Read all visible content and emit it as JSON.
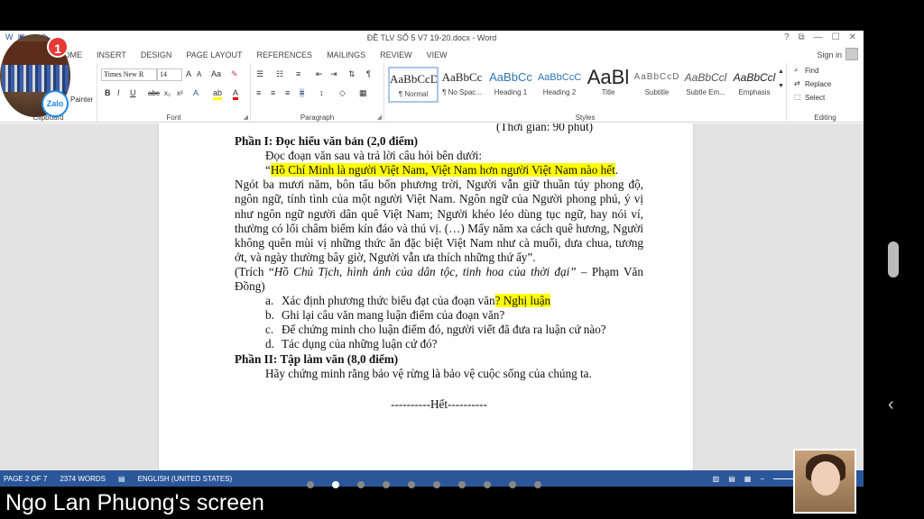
{
  "app": {
    "window_title": "ĐỀ TLV SỐ 5  V7 19-20.docx - Word",
    "window_controls": [
      "?",
      "⧉",
      "—",
      "☐",
      "✕"
    ],
    "tabs": [
      "HOME",
      "INSERT",
      "DESIGN",
      "PAGE LAYOUT",
      "REFERENCES",
      "MAILINGS",
      "REVIEW",
      "VIEW"
    ],
    "sign_in": "Sign in"
  },
  "ribbon": {
    "clipboard": {
      "label": "Clipboard",
      "format_painter": "Painter"
    },
    "font": {
      "label": "Font",
      "font_name": "Times New R",
      "font_size": "14",
      "grow": "A",
      "shrink": "A",
      "case": "Aa",
      "bold": "B",
      "italic": "I",
      "underline": "U",
      "strike": "abc",
      "sub": "x₂",
      "sup": "x²"
    },
    "paragraph": {
      "label": "Paragraph"
    },
    "styles": {
      "label": "Styles",
      "items": [
        {
          "preview": "AaBbCcDc",
          "name": "¶ Normal"
        },
        {
          "preview": "AaBbCc",
          "name": "¶ No Spac..."
        },
        {
          "preview": "AaBbCc",
          "name": "Heading 1"
        },
        {
          "preview": "AaBbCcC",
          "name": "Heading 2"
        },
        {
          "preview": "AaBl",
          "name": "Title"
        },
        {
          "preview": "AaBbCcD",
          "name": "Subtitle"
        },
        {
          "preview": "AaBbCcl",
          "name": "Subtle Em..."
        },
        {
          "preview": "AaBbCcl",
          "name": "Emphasis"
        }
      ]
    },
    "editing": {
      "label": "Editing",
      "find": "Find",
      "replace": "Replace",
      "select": "Select"
    }
  },
  "document": {
    "time": "(Thời gian: 90 phút)",
    "part1": "Phần I: Đọc hiểu văn bản (2,0 điểm)",
    "instruction": "Đọc đoạn văn sau và trả lời câu hỏi bên dưới:",
    "quote_open": "“",
    "quote_hl": "Hồ Chí Minh là người Việt Nam, Việt Nam hơn người Việt Nam nào hết",
    "quote_end": ".",
    "passage": "Ngót ba mươi năm, bôn tẩu bốn phương trời, Người vẫn giữ thuần túy phong độ, ngôn ngữ, tính tình của một người Việt Nam. Ngôn ngữ của Người phong phú, ý vị như ngôn ngữ người dân quê Việt Nam; Người khéo léo dùng tục ngữ, hay nói ví, thường có lối châm biếm kín đáo và thú vị. (…) Mấy năm xa cách quê hương, Người không quên mùi vị những thức ăn đặc biệt Việt Nam như cà muối, dưa chua, tương ớt, và ngày thường bây giờ, Người vẫn ưa thích những thứ ấy”.",
    "source_prefix": "(Trích “",
    "source_italic": "Hồ Chủ Tịch, hình ảnh của dân tộc, tinh hoa của thời đại”",
    "source_suffix": " – Phạm Văn Đồng)",
    "questions": [
      {
        "mark": "a.",
        "text": "Xác định phương thức biểu đạt của đoạn văn",
        "answer": "? Nghị luận"
      },
      {
        "mark": "b.",
        "text": "Ghi lại câu văn mang luận điểm của đoạn văn?",
        "answer": ""
      },
      {
        "mark": "c.",
        "text": "Để chứng minh cho luận điểm đó, người viết đã đưa ra luận cứ nào?",
        "answer": ""
      },
      {
        "mark": "d.",
        "text": "Tác dụng của những luận cứ đó?",
        "answer": ""
      }
    ],
    "part2": "Phần II: Tập làm văn (8,0 điểm)",
    "task": "Hãy chứng minh rằng bảo vệ rừng là bảo vệ cuộc sống của chúng ta.",
    "end": "----------Hết----------"
  },
  "status": {
    "page": "PAGE 2 OF 7",
    "words": "2374 WORDS",
    "language": "ENGLISH (UNITED STATES)"
  },
  "overlay": {
    "notification_count": "1",
    "zalo_label": "Zalo",
    "screen_label": "Ngo Lan Phuong's screen",
    "back_arrow": "‹",
    "page_dots": 10,
    "active_dot": 1
  },
  "colors": {
    "word_blue": "#2b579a",
    "highlight": "#ffff00",
    "badge_red": "#e53935"
  }
}
